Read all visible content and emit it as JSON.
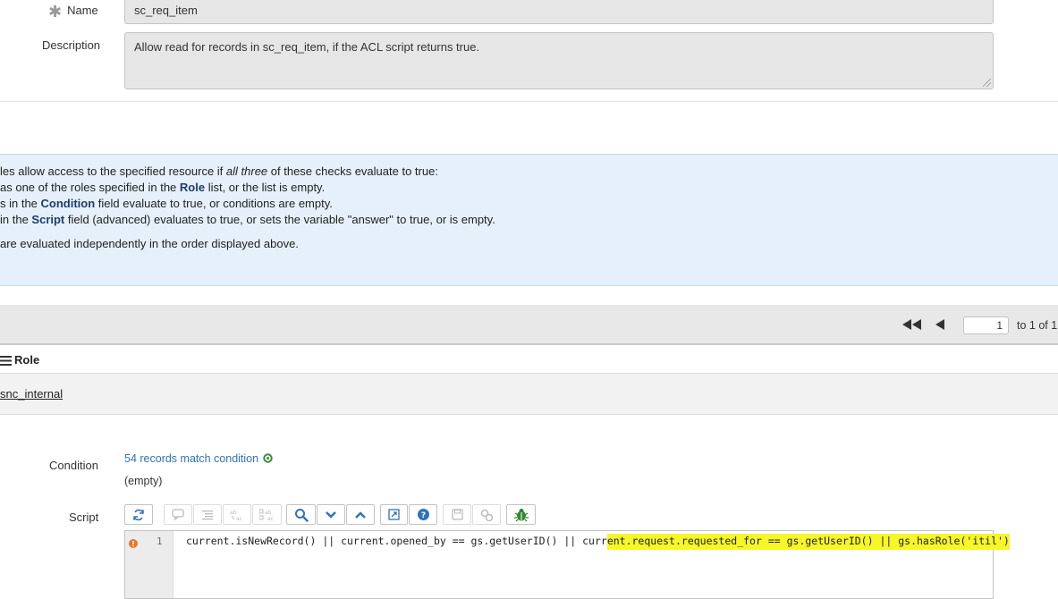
{
  "name_field": {
    "label": "Name",
    "value": "sc_req_item"
  },
  "description_field": {
    "label": "Description",
    "value": "Allow read for records in sc_req_item, if the ACL script returns true."
  },
  "info": {
    "line1_a": "les allow access to the specified resource if ",
    "line1_em": "all three",
    "line1_b": " of these checks evaluate to true:",
    "line2_a": "as one of the roles specified in the ",
    "line2_bold": "Role",
    "line2_b": " list, or the list is empty.",
    "line3_a": "s in the ",
    "line3_bold": "Condition",
    "line3_b": " field evaluate to true, or conditions are empty.",
    "line4_a": " in the ",
    "line4_bold": "Script",
    "line4_b": " field (advanced) evaluates to true, or sets the variable \"answer\" to true, or is empty.",
    "line5": "are evaluated independently in the order displayed above."
  },
  "pager": {
    "current": "1",
    "range_text": "to 1 of 1"
  },
  "role_list": {
    "header": "Role",
    "rows": [
      "snc_internal"
    ]
  },
  "condition": {
    "label": "Condition",
    "match_text": "54 records match condition",
    "empty_text": "(empty)"
  },
  "script": {
    "label": "Script",
    "line_number": "1",
    "code_before": "current.isNewRecord() || current.opened_by == gs.getUserID() || curr",
    "code_highlight": "ent.request.requested_for == gs.getUserID() || gs.hasRole('itil')"
  },
  "colors": {
    "info_bg": "#e5f0fa",
    "link": "#2e73b8",
    "highlight": "#f6f629"
  }
}
